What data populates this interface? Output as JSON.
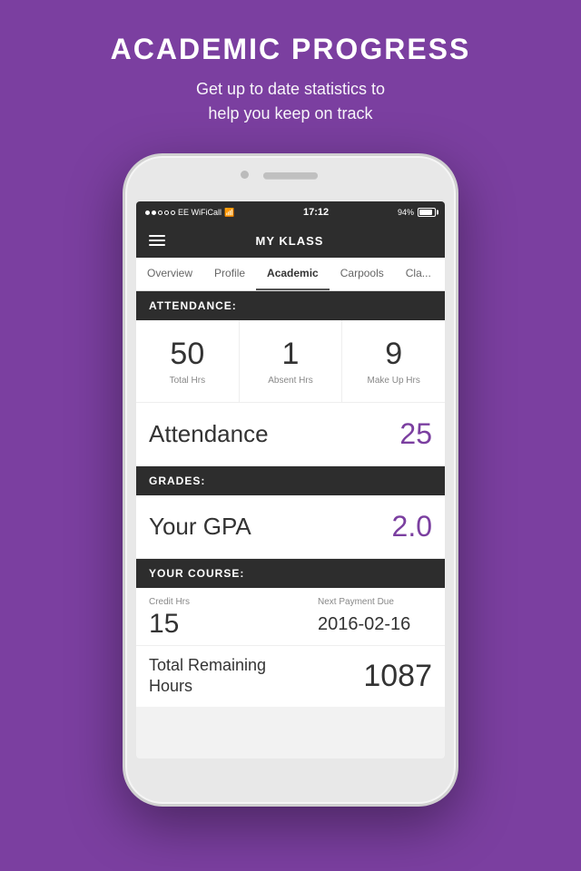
{
  "page": {
    "bg_color": "#7b3fa0",
    "heading": "ACADEMIC PROGRESS",
    "subheading": "Get up to date statistics to\nhelp you keep on track"
  },
  "status_bar": {
    "signal_dots": [
      "filled",
      "filled",
      "empty",
      "empty",
      "empty"
    ],
    "carrier": "EE WiFiCall",
    "time": "17:12",
    "battery_pct": "94%"
  },
  "nav": {
    "title": "MY KLASS",
    "menu_icon": "hamburger"
  },
  "tabs": [
    {
      "id": "overview",
      "label": "Overview",
      "active": false
    },
    {
      "id": "profile",
      "label": "Profile",
      "active": false
    },
    {
      "id": "academic",
      "label": "Academic",
      "active": true
    },
    {
      "id": "carpools",
      "label": "Carpools",
      "active": false
    },
    {
      "id": "class",
      "label": "Cla...",
      "active": false
    }
  ],
  "attendance_section": {
    "header": "ATTENDANCE:",
    "stats": [
      {
        "value": "50",
        "label": "Total Hrs"
      },
      {
        "value": "1",
        "label": "Absent Hrs"
      },
      {
        "value": "9",
        "label": "Make Up Hrs"
      }
    ],
    "score_label": "Attendance",
    "score_value": "25"
  },
  "grades_section": {
    "header": "GRADES:",
    "gpa_label": "Your GPA",
    "gpa_value": "2.0"
  },
  "course_section": {
    "header": "YOUR COURSE:",
    "credit_hrs_label": "Credit Hrs",
    "credit_hrs_value": "15",
    "next_payment_label": "Next Payment Due",
    "next_payment_value": "2016-02-16",
    "remaining_label": "Total Remaining\nHours",
    "remaining_value": "1087"
  }
}
